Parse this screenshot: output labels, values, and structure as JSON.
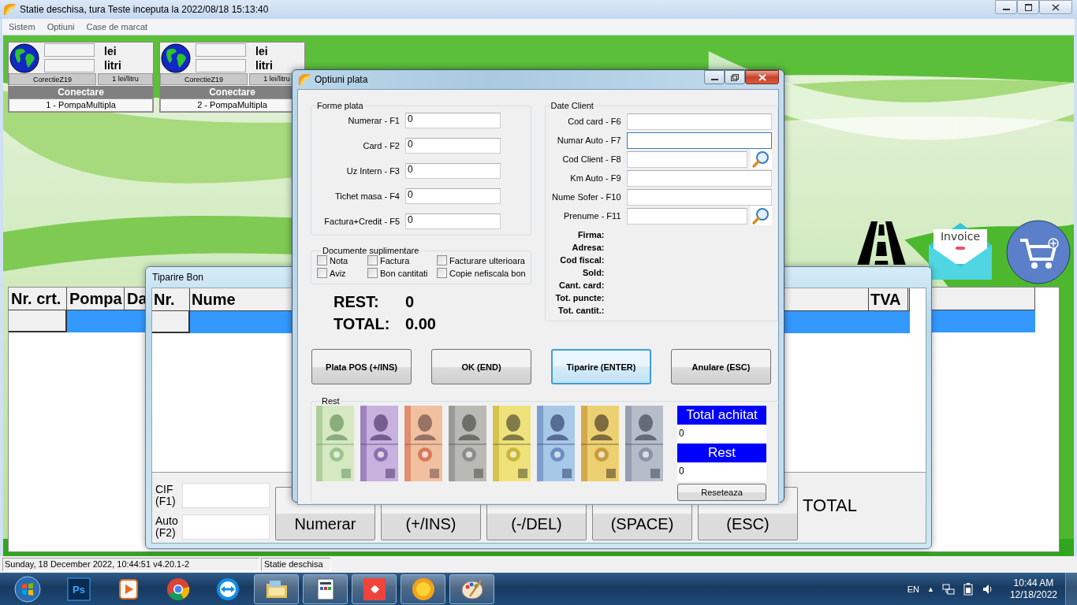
{
  "window": {
    "title": "Statie deschisa, tura Teste inceputa la 2022/08/18 15:13:40"
  },
  "menu": [
    {
      "label": "Sistem"
    },
    {
      "label": "Optiuni"
    },
    {
      "label": "Case de marcat"
    }
  ],
  "pumps": [
    {
      "amount_unit": "lei",
      "volume_unit": "litri",
      "correction": "CorectieZ19",
      "price": "1 lei/litru",
      "connect": "Conectare",
      "name": "1 - PompaMultipla"
    },
    {
      "amount_unit": "lei",
      "volume_unit": "litri",
      "correction": "CorectieZ19",
      "price": "1 lei/litru",
      "connect": "Conectare",
      "name": "2 - PompaMultipla"
    }
  ],
  "shortcuts": {
    "invoice_label": "Invoice"
  },
  "main_table": {
    "columns": [
      "Nr. crt.",
      "Pompa",
      "Da"
    ],
    "rows": [
      {
        "selected": true
      }
    ]
  },
  "print_window": {
    "title": "Tiparire Bon",
    "columns": [
      "Nr.",
      "Nume",
      "TVA"
    ],
    "rows": [
      {
        "selected": true
      }
    ],
    "fields": [
      {
        "label": "CIF (F1)"
      },
      {
        "label": "Auto (F2)"
      }
    ],
    "buttons": [
      {
        "label": "Numerar"
      },
      {
        "label": "(+/INS)"
      },
      {
        "label": "(-/DEL)"
      },
      {
        "label": "(SPACE)"
      },
      {
        "label": "(ESC)"
      }
    ],
    "total_label": "TOTAL"
  },
  "payment_dialog": {
    "title": "Optiuni plata",
    "payment_methods": {
      "title": "Forme plata",
      "fields": [
        {
          "label": "Numerar - F1",
          "value": "0"
        },
        {
          "label": "Card - F2",
          "value": "0"
        },
        {
          "label": "Uz Intern - F3",
          "value": "0"
        },
        {
          "label": "Tichet masa - F4",
          "value": "0"
        },
        {
          "label": "Factura+Credit - F5",
          "value": "0"
        }
      ]
    },
    "documents": {
      "title": "Documente suplimentare",
      "options": [
        {
          "label": "Nota",
          "checked": false
        },
        {
          "label": "Factura",
          "checked": false
        },
        {
          "label": "Facturare ulterioara",
          "checked": false
        },
        {
          "label": "Aviz",
          "checked": false
        },
        {
          "label": "Bon cantitati",
          "checked": false
        },
        {
          "label": "Copie nefiscala bon",
          "checked": false
        }
      ]
    },
    "rest": {
      "label": "REST:",
      "value": "0"
    },
    "total": {
      "label": "TOTAL:",
      "value": "0.00"
    },
    "client": {
      "title": "Date Client",
      "fields": [
        {
          "label": "Cod card - F6",
          "focused": false,
          "search": false
        },
        {
          "label": "Numar Auto - F7",
          "focused": true,
          "search": false
        },
        {
          "label": "Cod Client - F8",
          "focused": false,
          "search": true
        },
        {
          "label": "Km Auto - F9",
          "focused": false,
          "search": false
        },
        {
          "label": "Nume Sofer - F10",
          "focused": false,
          "search": false
        },
        {
          "label": "Prenume - F11",
          "focused": false,
          "search": true
        }
      ],
      "info": [
        "Firma:",
        "Adresa:",
        "Cod fiscal:",
        "Sold:",
        "Cant. card:",
        "Tot. puncte:",
        "Tot. cantit.:"
      ]
    },
    "buttons": [
      {
        "label": "Plata POS (+/INS)",
        "focused": false
      },
      {
        "label": "OK (END)",
        "focused": false
      },
      {
        "label": "Tiparire (ENTER)",
        "focused": true
      },
      {
        "label": "Anulare (ESC)",
        "focused": false
      }
    ],
    "change": {
      "title": "Rest",
      "total_paid": {
        "label": "Total achitat",
        "value": "0"
      },
      "rest": {
        "label": "Rest",
        "value": "0"
      },
      "reset": "Reseteaza"
    }
  },
  "status_bar": [
    "Sunday, 18 December 2022, 10:44:51 v4.20.1-2",
    "Statie deschisa"
  ],
  "taskbar": {
    "apps": [
      {
        "kind": "photoshop",
        "label": "Ps",
        "running": false
      },
      {
        "kind": "media",
        "running": false
      },
      {
        "kind": "chrome",
        "running": false
      },
      {
        "kind": "teamviewer",
        "running": false
      },
      {
        "kind": "explorer",
        "running": true
      },
      {
        "kind": "document",
        "running": true
      },
      {
        "kind": "anydesk",
        "running": true
      },
      {
        "kind": "sun",
        "running": true
      },
      {
        "kind": "paint",
        "running": true
      }
    ],
    "language": "EN",
    "tray_arrow": "▲",
    "time": "10:44 AM",
    "date": "12/18/2022"
  }
}
